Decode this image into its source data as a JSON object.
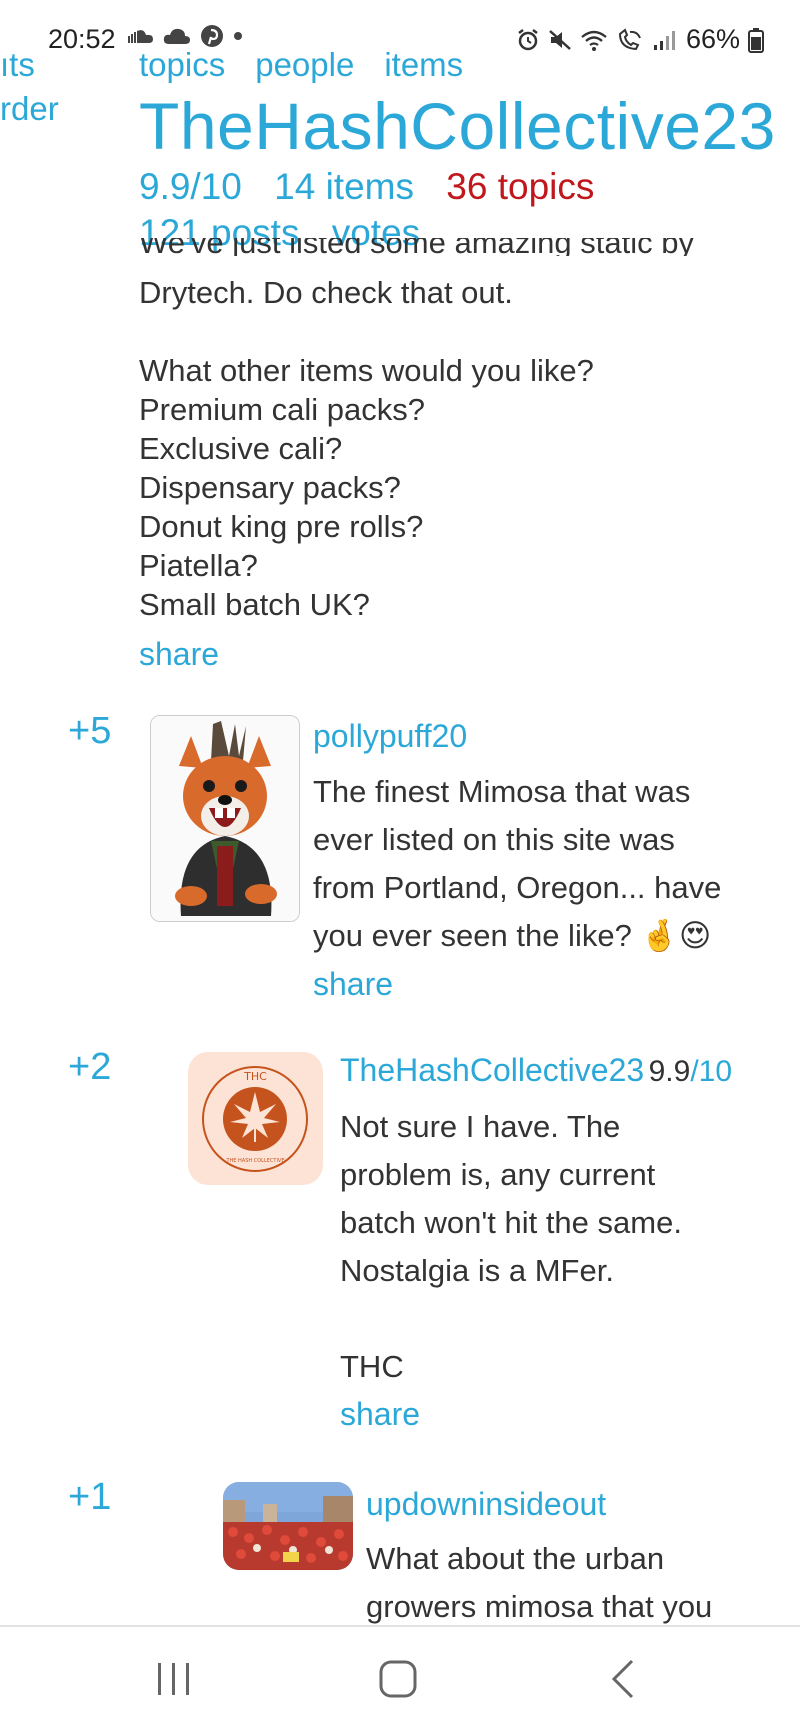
{
  "status_bar": {
    "time": "20:52",
    "battery": "66%",
    "left_icons": [
      "soundcloud-icon",
      "cloud-icon",
      "pinterest-icon",
      "dot-icon"
    ],
    "right_icons": [
      "alarm-icon",
      "mute-icon",
      "wifi-icon",
      "wifi-call-icon",
      "signal-icon",
      "battery-icon"
    ]
  },
  "header": {
    "nav_cut_left_1": "ıts",
    "nav_cut_left_2": "rder",
    "nav": [
      "topics",
      "people",
      "items"
    ],
    "title": "TheHashCollective23",
    "rating": "9.9/10",
    "items_count": "14 items",
    "topics_count": "36 topics",
    "posts_count": "121 posts",
    "votes": "votes"
  },
  "intro_post": {
    "cut_line": "We've just listed some amazing static by",
    "lines": [
      "Drytech. Do check that out.",
      "",
      "What other items would you like?",
      "Premium cali packs?",
      "Exclusive cali?",
      "Dispensary packs?",
      "Donut king pre rolls?",
      "Piatella?",
      "Small batch UK?"
    ],
    "share": "share"
  },
  "comments": [
    {
      "votes": "+5",
      "user": "pollypuff20",
      "lines": [
        "The finest Mimosa that was",
        "ever listed on this site was",
        "from Portland, Oregon... have",
        "you ever seen the like? 🤞😍"
      ],
      "share": "share"
    },
    {
      "votes": "+2",
      "user": "TheHashCollective23",
      "score_num": "9.9",
      "score_den": "/10",
      "lines": [
        "Not sure I have. The",
        "problem is, any current",
        "batch won't hit the same.",
        "Nostalgia is a MFer.",
        "",
        "THC"
      ],
      "share": "share",
      "logo_text_top": "THC",
      "logo_text_bottom": "THE HASH COLLECTIVE"
    },
    {
      "votes": "+1",
      "user": "updowninsideout",
      "lines": [
        "What about the urban",
        "growers mimosa that you"
      ]
    }
  ],
  "colors": {
    "link": "#2ba8d8",
    "accent_red": "#c0171c",
    "text": "#333333",
    "thc_orange": "#c5531d",
    "thc_bg": "#fde3d6"
  }
}
